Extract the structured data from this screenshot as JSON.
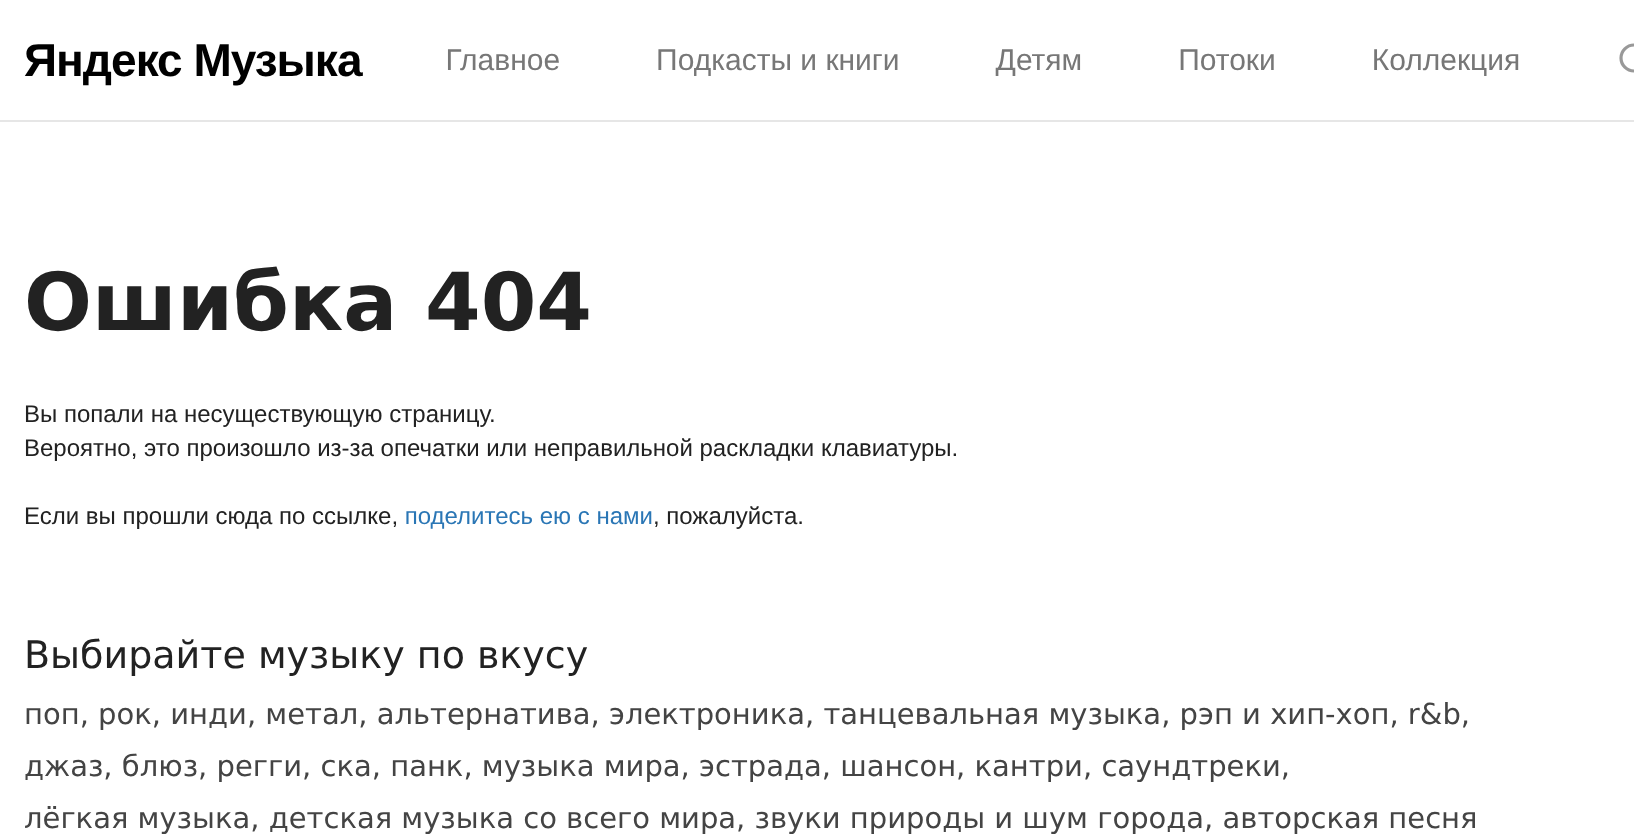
{
  "header": {
    "logo": "Яндекс Музыка",
    "nav": [
      {
        "label": "Главное"
      },
      {
        "label": "Подкасты и книги"
      },
      {
        "label": "Детям"
      },
      {
        "label": "Потоки"
      },
      {
        "label": "Коллекция"
      }
    ]
  },
  "error": {
    "title": "Ошибка 404",
    "lines": [
      "Вы попали на несуществующую страницу.",
      "Вероятно, это произошло из-за опечатки или неправильной раскладки клавиатуры."
    ],
    "share": {
      "before": "Если вы прошли сюда по ссылке, ",
      "link": "поделитесь ею с нами",
      "after": ", пожалуйста."
    }
  },
  "genres": {
    "title": "Выбирайте музыку по вкусу",
    "lines": [
      "поп, рок, инди, метал, альтернатива, электроника, танцевальная музыка, рэп и хип-хоп, r&b,",
      "джаз, блюз, регги, ска, панк, музыка мира, эстрада, шансон, кантри, саундтреки,",
      "лёгкая музыка, детская музыка со всего мира, звуки природы и шум города, авторская песня"
    ]
  }
}
